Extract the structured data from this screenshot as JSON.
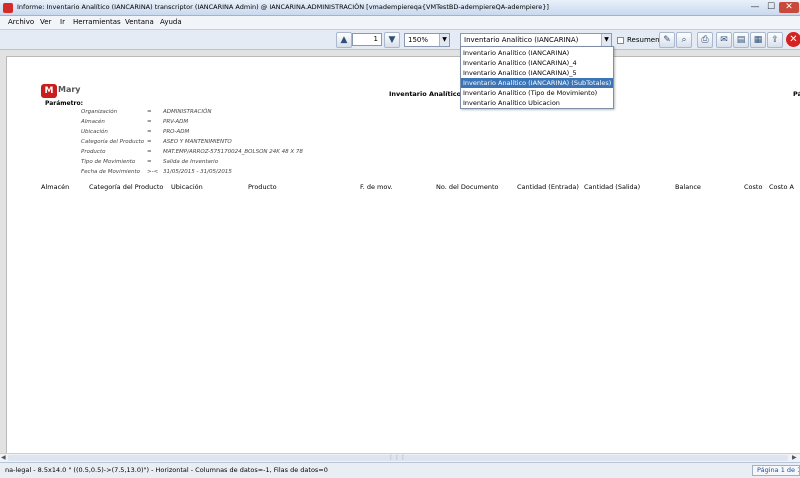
{
  "window": {
    "title": "Informe: Inventario Analítico (IANCARINA)  transcriptor (IANCARINA Admin) @ IANCARINA.ADMINISTRACIÓN [vmadempiereqa{VMTestBD-adempiereQA-adempiere}]",
    "minimize": "—",
    "maximize": "☐",
    "close": "✕"
  },
  "menu": [
    "Archivo",
    "Ver",
    "Ir",
    "Herramientas",
    "Ventana",
    "Ayuda"
  ],
  "toolbar": {
    "page": "1",
    "zoom": "150%",
    "report": "Inventario Analítico (IANCARINA)",
    "summary_label": "Resumen"
  },
  "dropdown": {
    "options": [
      "Inventario Analítico (IANCARINA)",
      "Inventario Analítico (IANCARINA)_4",
      "Inventario Analítico (IANCARINA)_5",
      "Inventario Analítico (IANCARINA) (SubTotales)",
      "Inventario Analítico (Tipo de Movimiento)",
      "Inventario Analítico Ubicacion"
    ],
    "selected_index": 3
  },
  "report": {
    "logo_text": "Mary",
    "title": "Inventario Analítico (IANC",
    "page_label": "Pá",
    "params_heading": "Parámetro:",
    "params": [
      {
        "label": "Organización",
        "op": "=",
        "value": "ADMINISTRACIÓN"
      },
      {
        "label": "Almacén",
        "op": "=",
        "value": "PRV-ADM"
      },
      {
        "label": "Ubicación",
        "op": "=",
        "value": "PRO-ADM"
      },
      {
        "label": "Categoría del Producto",
        "op": "=",
        "value": "ASEO Y MANTENIMIENTO"
      },
      {
        "label": "Producto",
        "op": "=",
        "value": "MAT.EMP/ARROZ-575170024_BOLSON 24K 48 X 78"
      },
      {
        "label": "Tipo de Movimiento",
        "op": "=",
        "value": "Salida de Inventario"
      },
      {
        "label": "Fecha de Movimiento",
        "op": ">-<",
        "value": "31/05/2015 - 31/05/2015"
      }
    ],
    "columns": [
      "Almacén",
      "Categoría del Producto",
      "Ubicación",
      "Producto",
      "F. de mov.",
      "No. del Documento",
      "Cantidad (Entrada)",
      "Cantidad (Salida)",
      "Balance",
      "Costo",
      "Costo A"
    ]
  },
  "status": {
    "info": "na-legal - 8.5x14.0 \" ((0.5,0.5)->(7.5,13.0)\") - Horizontal - Columnas de datos=-1, Filas de datos=0",
    "page": "Página 1 de 1"
  }
}
